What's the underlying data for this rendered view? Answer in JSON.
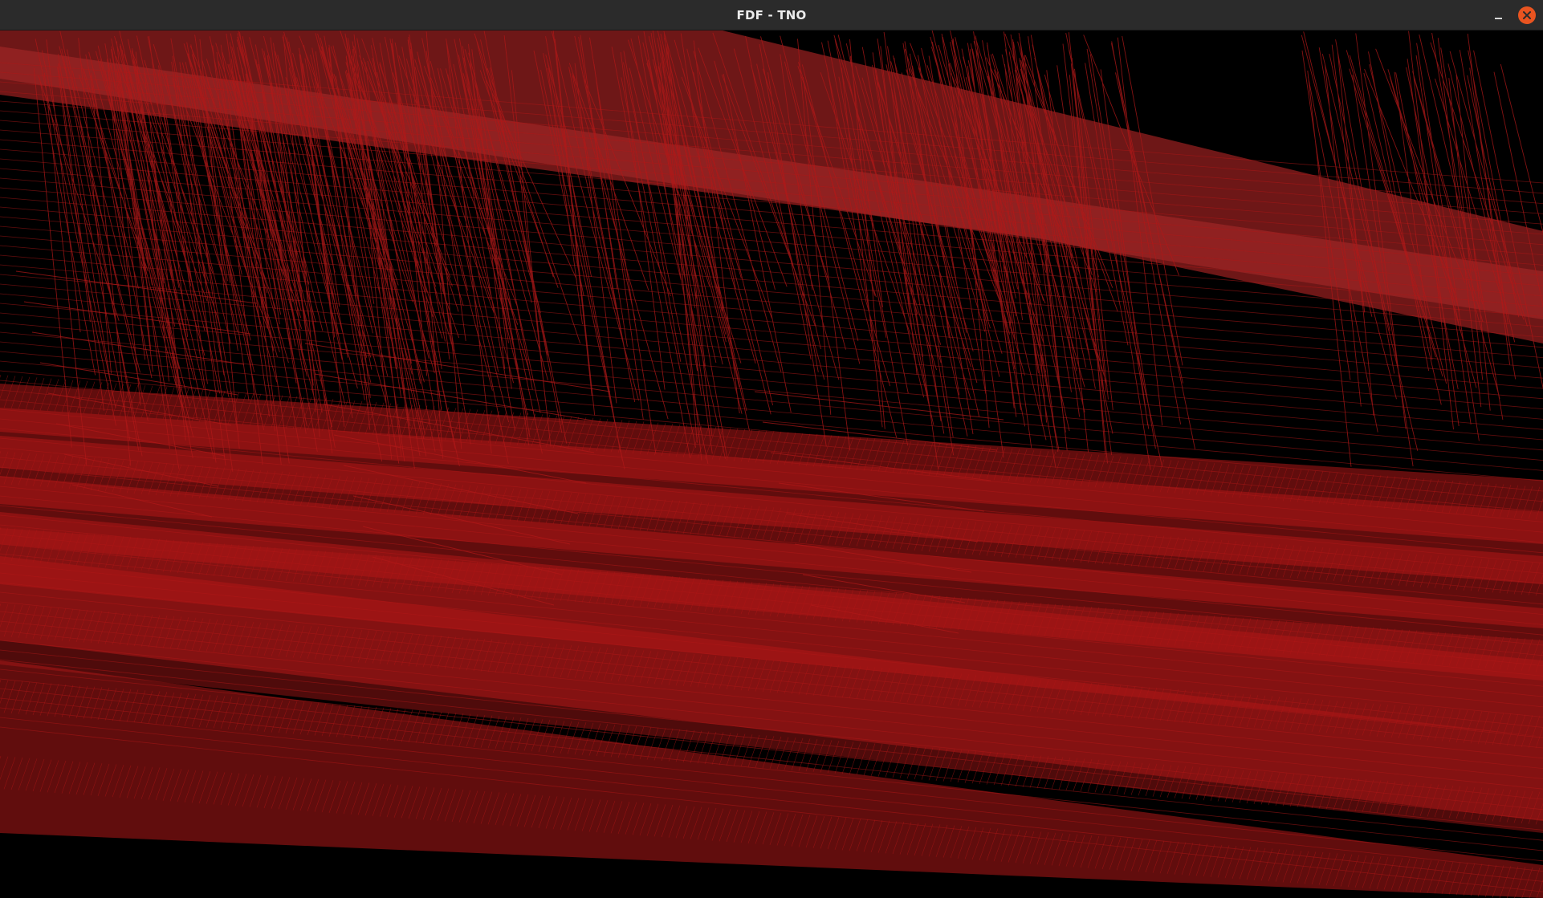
{
  "window": {
    "title": "FDF - TNO"
  },
  "controls": {
    "minimize": "minimize-icon",
    "close": "close-icon"
  },
  "render": {
    "mode": "wireframe",
    "background": "#000000",
    "line_color": "#b01818"
  },
  "colors": {
    "titlebar": "#2b2b2b",
    "close_button": "#e95420"
  }
}
